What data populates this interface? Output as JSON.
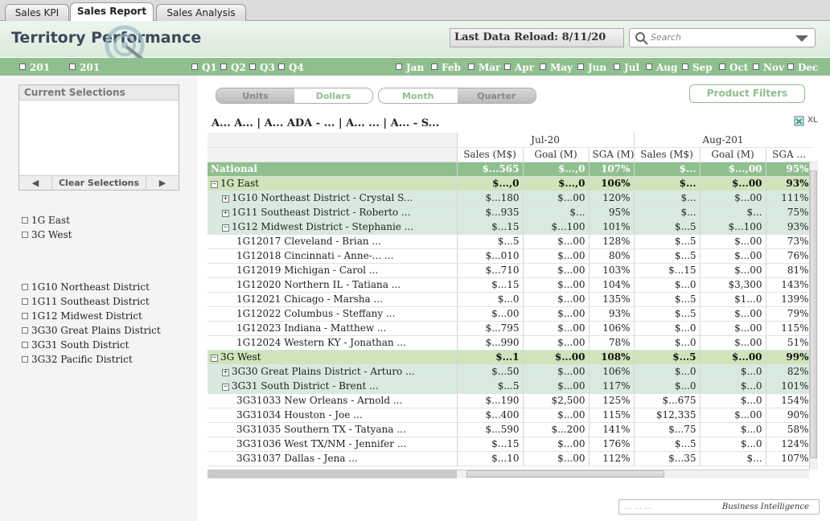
{
  "tabs": [
    {
      "label": "Sales KPI",
      "active": false
    },
    {
      "label": "Sales Report",
      "active": true
    },
    {
      "label": "Sales Analysis",
      "active": false
    }
  ],
  "header": {
    "title": "Territory Performance",
    "reload": "Last Data Reload: 8/11/20",
    "search_placeholder": "Search"
  },
  "filters": {
    "years": [
      "201",
      "201"
    ],
    "quarters": [
      "Q1",
      "Q2",
      "Q3",
      "Q4"
    ],
    "months": [
      "Jan",
      "Feb",
      "Mar",
      "Apr",
      "May",
      "Jun",
      "Jul",
      "Aug",
      "Sep",
      "Oct",
      "Nov",
      "Dec"
    ]
  },
  "left": {
    "current_selections": "Current Selections",
    "clear": "Clear Selections",
    "regions": [
      "1G East",
      "3G West"
    ],
    "districts": [
      "1G10 Northeast District",
      "1G11 Southeast District",
      "1G12 Midwest District",
      "3G30 Great Plains District",
      "3G31 South District",
      "3G32 Pacific District"
    ]
  },
  "toggles": {
    "measure": [
      "Units",
      "Dollars"
    ],
    "period": [
      "Month",
      "Quarter"
    ],
    "product_filters": "Product Filters"
  },
  "summary": "A... A... | A... ADA - ... | A... ... | A... - S...",
  "xl_label": "XL",
  "table": {
    "months": [
      "Jul-20",
      "Aug-201"
    ],
    "columns": [
      "Sales (M$)",
      "Goal (M)",
      "SGA (M)",
      "Sales (M$)",
      "Goal (M)",
      "SGA ..."
    ],
    "rows": [
      {
        "level": "national",
        "label": "National",
        "cells": [
          "$...565",
          "$...,0",
          "107%",
          "$...",
          "$...,00",
          "95%"
        ]
      },
      {
        "level": "region",
        "exp": "−",
        "label": "1G East",
        "cells": [
          "$...,0",
          "$...,0",
          "106%",
          "$...",
          "$...00",
          "93%"
        ]
      },
      {
        "level": "district",
        "exp": "+",
        "label": "1G10 Northeast District - Crystal S...",
        "cells": [
          "$...180",
          "$...00",
          "120%",
          "$...",
          "$...00",
          "111%"
        ]
      },
      {
        "level": "district",
        "exp": "+",
        "label": "1G11 Southeast District - Roberto ...",
        "cells": [
          "$...935",
          "$...",
          "95%",
          "$...",
          "$...",
          "75%"
        ]
      },
      {
        "level": "district",
        "exp": "−",
        "label": "1G12 Midwest District - Stephanie ...",
        "cells": [
          "$...15",
          "$...100",
          "101%",
          "$...5",
          "$...100",
          "93%"
        ]
      },
      {
        "level": "leaf",
        "label": "1G12017 Cleveland - Brian ...",
        "cells": [
          "$...5",
          "$...00",
          "128%",
          "$...5",
          "$...00",
          "73%"
        ]
      },
      {
        "level": "leaf",
        "label": "1G12018 Cincinnati - Anne-... ...",
        "cells": [
          "$...010",
          "$...00",
          "80%",
          "$...5",
          "$...00",
          "76%"
        ]
      },
      {
        "level": "leaf",
        "label": "1G12019 Michigan - Carol ...",
        "cells": [
          "$...710",
          "$...00",
          "103%",
          "$...15",
          "$...00",
          "81%"
        ]
      },
      {
        "level": "leaf",
        "label": "1G12020 Northern IL - Tatiana ...",
        "cells": [
          "$...15",
          "$...00",
          "104%",
          "$...0",
          "$3,300",
          "143%"
        ]
      },
      {
        "level": "leaf",
        "label": "1G12021 Chicago - Marsha ...",
        "cells": [
          "$...0",
          "$...00",
          "135%",
          "$...5",
          "$1...0",
          "139%"
        ]
      },
      {
        "level": "leaf",
        "label": "1G12022 Columbus - Steffany ...",
        "cells": [
          "$...00",
          "$...00",
          "93%",
          "$...5",
          "$...00",
          "79%"
        ]
      },
      {
        "level": "leaf",
        "label": "1G12023 Indiana - Matthew ...",
        "cells": [
          "$...795",
          "$...00",
          "106%",
          "$...0",
          "$...00",
          "115%"
        ]
      },
      {
        "level": "leaf",
        "label": "1G12024 Western KY - Jonathan ...",
        "cells": [
          "$...990",
          "$...00",
          "78%",
          "$...0",
          "$...00",
          "51%"
        ]
      },
      {
        "level": "region",
        "exp": "−",
        "label": "3G West",
        "cells": [
          "$...1",
          "$...00",
          "108%",
          "$...5",
          "$...00",
          "99%"
        ]
      },
      {
        "level": "district",
        "exp": "+",
        "label": "3G30 Great Plains District - Arturo ...",
        "cells": [
          "$...50",
          "$...00",
          "106%",
          "$...0",
          "$...0",
          "82%"
        ]
      },
      {
        "level": "district",
        "exp": "−",
        "label": "3G31 South District - Brent ...",
        "cells": [
          "$...5",
          "$...00",
          "117%",
          "$...0",
          "$...0",
          "101%"
        ]
      },
      {
        "level": "leaf",
        "label": "3G31033 New Orleans - Arnold ...",
        "cells": [
          "$...190",
          "$2,500",
          "125%",
          "$...675",
          "$...0",
          "154%"
        ]
      },
      {
        "level": "leaf",
        "label": "3G31034 Houston - Joe ...",
        "cells": [
          "$...400",
          "$...00",
          "115%",
          "$12,335",
          "$...00",
          "90%"
        ]
      },
      {
        "level": "leaf",
        "label": "3G31035 Southern TX - Tatyana ...",
        "cells": [
          "$...590",
          "$...200",
          "141%",
          "$...75",
          "$...0",
          "58%"
        ]
      },
      {
        "level": "leaf",
        "label": "3G31036 West TX/NM - Jennifer ...",
        "cells": [
          "$...15",
          "$...00",
          "176%",
          "$...5",
          "$...0",
          "124%"
        ]
      },
      {
        "level": "leaf",
        "label": "3G31037 Dallas - Jena ...",
        "cells": [
          "$...10",
          "$...00",
          "112%",
          "$...35",
          "$...",
          "107%"
        ]
      }
    ]
  },
  "footer": {
    "developer": "... ... ...",
    "brand": "Business Intelligence"
  },
  "colors": {
    "accent_green": "#8fbf8f",
    "region_green": "#cfe4bb",
    "district_green": "#d8eadf"
  }
}
